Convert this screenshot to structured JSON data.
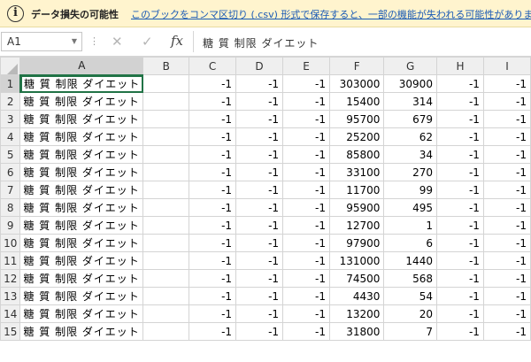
{
  "warning": {
    "icon": "info-icon",
    "icon_glyph": "i",
    "title": "データ損失の可能性",
    "message": "このブックをコンマ区切り (.csv) 形式で保存すると、一部の機能が失われる可能性があります。機能が失わないようにするには"
  },
  "formula_bar": {
    "name_box": "A1",
    "formula": "糖 質 制限 ダイエット",
    "fx_label": "fx"
  },
  "sheet": {
    "columns": [
      "A",
      "B",
      "C",
      "D",
      "E",
      "F",
      "G",
      "H",
      "I"
    ],
    "rows": [
      {
        "num": "1",
        "a": "糖 質 制限 ダイエット",
        "c": "-1",
        "d": "-1",
        "e": "-1",
        "f": "303000",
        "g": "30900",
        "h": "-1",
        "i": "-1"
      },
      {
        "num": "2",
        "a": "糖 質 制限 ダイエット",
        "c": "-1",
        "d": "-1",
        "e": "-1",
        "f": "15400",
        "g": "314",
        "h": "-1",
        "i": "-1"
      },
      {
        "num": "3",
        "a": "糖 質 制限 ダイエット",
        "c": "-1",
        "d": "-1",
        "e": "-1",
        "f": "95700",
        "g": "679",
        "h": "-1",
        "i": "-1"
      },
      {
        "num": "4",
        "a": "糖 質 制限 ダイエット",
        "c": "-1",
        "d": "-1",
        "e": "-1",
        "f": "25200",
        "g": "62",
        "h": "-1",
        "i": "-1"
      },
      {
        "num": "5",
        "a": "糖 質 制限 ダイエット",
        "c": "-1",
        "d": "-1",
        "e": "-1",
        "f": "85800",
        "g": "34",
        "h": "-1",
        "i": "-1"
      },
      {
        "num": "6",
        "a": "糖 質 制限 ダイエット",
        "c": "-1",
        "d": "-1",
        "e": "-1",
        "f": "33100",
        "g": "270",
        "h": "-1",
        "i": "-1"
      },
      {
        "num": "7",
        "a": "糖 質 制限 ダイエット",
        "c": "-1",
        "d": "-1",
        "e": "-1",
        "f": "11700",
        "g": "99",
        "h": "-1",
        "i": "-1"
      },
      {
        "num": "8",
        "a": "糖 質 制限 ダイエット",
        "c": "-1",
        "d": "-1",
        "e": "-1",
        "f": "95900",
        "g": "495",
        "h": "-1",
        "i": "-1"
      },
      {
        "num": "9",
        "a": "糖 質 制限 ダイエット",
        "c": "-1",
        "d": "-1",
        "e": "-1",
        "f": "12700",
        "g": "1",
        "h": "-1",
        "i": "-1"
      },
      {
        "num": "10",
        "a": "糖 質 制限 ダイエット",
        "c": "-1",
        "d": "-1",
        "e": "-1",
        "f": "97900",
        "g": "6",
        "h": "-1",
        "i": "-1"
      },
      {
        "num": "11",
        "a": "糖 質 制限 ダイエット",
        "c": "-1",
        "d": "-1",
        "e": "-1",
        "f": "131000",
        "g": "1440",
        "h": "-1",
        "i": "-1"
      },
      {
        "num": "12",
        "a": "糖 質 制限 ダイエット",
        "c": "-1",
        "d": "-1",
        "e": "-1",
        "f": "74500",
        "g": "568",
        "h": "-1",
        "i": "-1"
      },
      {
        "num": "13",
        "a": "糖 質 制限 ダイエット",
        "c": "-1",
        "d": "-1",
        "e": "-1",
        "f": "4430",
        "g": "54",
        "h": "-1",
        "i": "-1"
      },
      {
        "num": "14",
        "a": "糖 質 制限 ダイエット",
        "c": "-1",
        "d": "-1",
        "e": "-1",
        "f": "13200",
        "g": "20",
        "h": "-1",
        "i": "-1"
      },
      {
        "num": "15",
        "a": "糖 質 制限 ダイエット",
        "c": "-1",
        "d": "-1",
        "e": "-1",
        "f": "31800",
        "g": "7",
        "h": "-1",
        "i": "-1"
      }
    ]
  },
  "colors": {
    "accent": "#217346",
    "warning_bg": "#fff4ce",
    "link": "#1a5bb5"
  }
}
